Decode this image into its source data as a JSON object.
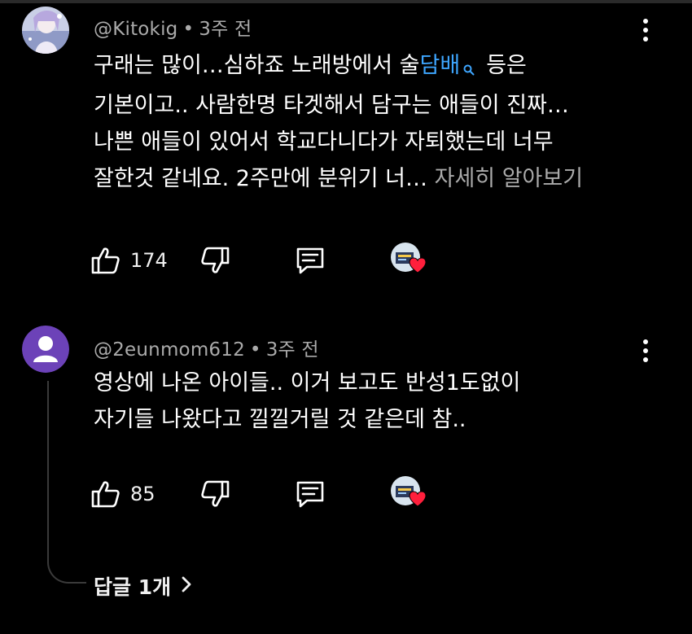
{
  "comments": [
    {
      "author": "@Kitokig",
      "time": "3주 전",
      "lines": [
        {
          "before": "구래는 많이…심하죠 노래방에서 술",
          "link": "담배",
          "after": "등은"
        },
        {
          "text": "기본이고.. 사람한명 타겟해서 담구는 애들이 진짜…"
        },
        {
          "text": "나쁜 애들이 있어서 학교다니다가 자퇴했는데 너무"
        },
        {
          "text": "잘한것 같네요. 2주만에 분위기 너…",
          "more": "자세히 알아보기"
        }
      ],
      "likes": "174"
    },
    {
      "author": "@2eunmom612",
      "time": "3주 전",
      "lines": [
        {
          "text": "영상에 나온 아이들.. 이거 보고도 반성1도없이"
        },
        {
          "text": "자기들 나왔다고 낄낄거릴 것 같은데 참.."
        }
      ],
      "likes": "85",
      "replies_label": "답글 1개"
    }
  ],
  "icons": {
    "like": "thumbs-up-icon",
    "dislike": "thumbs-down-icon",
    "reply": "comment-icon",
    "heart": "creator-heart-icon",
    "more": "more-vertical-icon",
    "search": "search-icon",
    "chevron": "chevron-right-icon"
  },
  "colors": {
    "background": "#000000",
    "text": "#f1f1f1",
    "meta": "#aaaaaa",
    "link": "#3ea6ff",
    "heart": "#ff1f3c",
    "default_avatar": "#6c42b8"
  }
}
